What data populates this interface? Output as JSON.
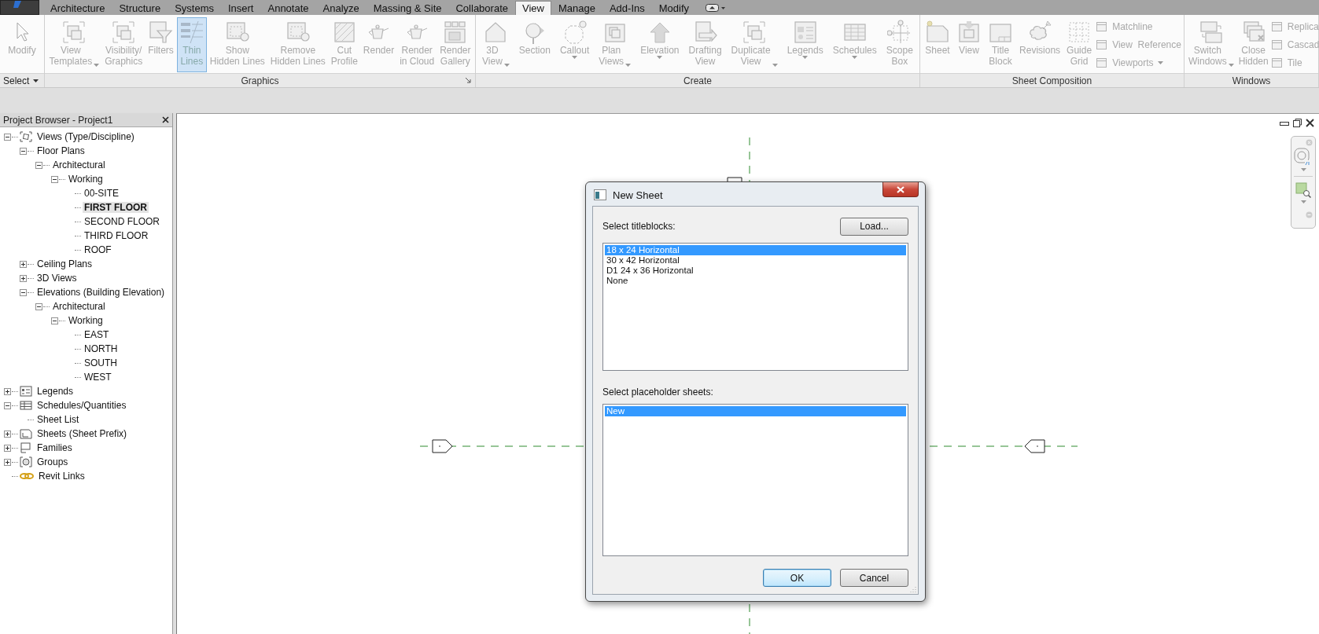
{
  "ribbon_tabs": [
    {
      "label": "Architecture",
      "selected": false
    },
    {
      "label": "Structure",
      "selected": false
    },
    {
      "label": "Systems",
      "selected": false
    },
    {
      "label": "Insert",
      "selected": false
    },
    {
      "label": "Annotate",
      "selected": false
    },
    {
      "label": "Analyze",
      "selected": false
    },
    {
      "label": "Massing & Site",
      "selected": false
    },
    {
      "label": "Collaborate",
      "selected": false
    },
    {
      "label": "View",
      "selected": true
    },
    {
      "label": "Manage",
      "selected": false
    },
    {
      "label": "Add-Ins",
      "selected": false
    },
    {
      "label": "Modify",
      "selected": false
    }
  ],
  "ribbon": {
    "disabled": true,
    "panels": [
      {
        "title": "Select",
        "dropdown": true,
        "launcher": false,
        "tools": [
          {
            "kind": "large",
            "label": "Modify",
            "selected": false,
            "dropdown": false
          }
        ]
      },
      {
        "title": "Graphics",
        "dropdown": false,
        "launcher": true,
        "tools": [
          {
            "kind": "large",
            "label": "View\nTemplates",
            "selected": false,
            "dropdown": true
          },
          {
            "kind": "large",
            "label": "Visibility/\nGraphics",
            "selected": false,
            "dropdown": false
          },
          {
            "kind": "large",
            "label": "Filters",
            "selected": false,
            "dropdown": false
          },
          {
            "kind": "large",
            "label": "Thin\nLines",
            "selected": true,
            "dropdown": false
          },
          {
            "kind": "large",
            "label": "Show\nHidden Lines",
            "selected": false,
            "dropdown": false
          },
          {
            "kind": "large",
            "label": "Remove\nHidden Lines",
            "selected": false,
            "dropdown": false
          },
          {
            "kind": "large",
            "label": "Cut\nProfile",
            "selected": false,
            "dropdown": false
          },
          {
            "kind": "large",
            "label": "Render",
            "selected": false,
            "dropdown": false
          },
          {
            "kind": "large",
            "label": "Render\nin Cloud",
            "selected": false,
            "dropdown": false
          },
          {
            "kind": "large",
            "label": "Render\nGallery",
            "selected": false,
            "dropdown": false
          }
        ]
      },
      {
        "title": "Create",
        "dropdown": false,
        "launcher": false,
        "tools": [
          {
            "kind": "large",
            "label": "3D\nView",
            "selected": false,
            "dropdown": true
          },
          {
            "kind": "large",
            "label": "Section",
            "selected": false,
            "dropdown": false
          },
          {
            "kind": "large",
            "label": "Callout",
            "selected": false,
            "dropdown": true
          },
          {
            "kind": "large",
            "label": "Plan\nViews",
            "selected": false,
            "dropdown": true
          },
          {
            "kind": "large",
            "label": "Elevation",
            "selected": false,
            "dropdown": true
          },
          {
            "kind": "large",
            "label": "Drafting\nView",
            "selected": false,
            "dropdown": false
          },
          {
            "kind": "large",
            "label": "Duplicate\nView",
            "selected": false,
            "dropdown": true
          },
          {
            "kind": "large",
            "label": "Legends",
            "selected": false,
            "dropdown": true
          },
          {
            "kind": "large",
            "label": "Schedules",
            "selected": false,
            "dropdown": true
          },
          {
            "kind": "large",
            "label": "Scope\nBox",
            "selected": false,
            "dropdown": false
          }
        ]
      },
      {
        "title": "Sheet Composition",
        "dropdown": false,
        "launcher": false,
        "tools": [
          {
            "kind": "large",
            "label": "Sheet",
            "selected": false,
            "dropdown": false
          },
          {
            "kind": "large",
            "label": "View",
            "selected": false,
            "dropdown": false
          },
          {
            "kind": "large",
            "label": "Title\nBlock",
            "selected": false,
            "dropdown": false
          },
          {
            "kind": "large",
            "label": "Revisions",
            "selected": false,
            "dropdown": false
          },
          {
            "kind": "large",
            "label": "Guide\nGrid",
            "selected": false,
            "dropdown": false
          },
          {
            "kind": "small",
            "label": "Matchline",
            "selected": false,
            "dropdown": false
          },
          {
            "kind": "small",
            "label": "View  Reference",
            "selected": false,
            "dropdown": false
          },
          {
            "kind": "small",
            "label": "Viewports",
            "selected": false,
            "dropdown": true
          }
        ]
      },
      {
        "title": "Windows",
        "dropdown": false,
        "launcher": false,
        "tools": [
          {
            "kind": "large",
            "label": "Switch\nWindows",
            "selected": false,
            "dropdown": true
          },
          {
            "kind": "large",
            "label": "Close\nHidden",
            "selected": false,
            "dropdown": false
          },
          {
            "kind": "small",
            "label": "Replica",
            "selected": false
          },
          {
            "kind": "small",
            "label": "Cascad",
            "selected": false
          },
          {
            "kind": "small",
            "label": "Tile",
            "selected": false
          }
        ]
      }
    ]
  },
  "project_browser": {
    "title": "Project Browser - Project1",
    "tree": [
      {
        "label": "Views (Type/Discipline)",
        "selected": false,
        "expanded": true,
        "children": [
          {
            "label": "Floor Plans",
            "selected": false,
            "expanded": true,
            "children": [
              {
                "label": "Architectural",
                "selected": false,
                "expanded": true,
                "children": [
                  {
                    "label": "Working",
                    "selected": false,
                    "expanded": true,
                    "children": [
                      {
                        "label": "00-SITE",
                        "selected": false
                      },
                      {
                        "label": "FIRST FLOOR",
                        "selected": true
                      },
                      {
                        "label": "SECOND FLOOR",
                        "selected": false
                      },
                      {
                        "label": "THIRD FLOOR",
                        "selected": false
                      },
                      {
                        "label": "ROOF",
                        "selected": false
                      }
                    ]
                  }
                ]
              }
            ]
          },
          {
            "label": "Ceiling Plans",
            "selected": false,
            "expanded": false
          },
          {
            "label": "3D Views",
            "selected": false,
            "expanded": false
          },
          {
            "label": "Elevations (Building Elevation)",
            "selected": false,
            "expanded": true,
            "children": [
              {
                "label": "Architectural",
                "selected": false,
                "expanded": true,
                "children": [
                  {
                    "label": "Working",
                    "selected": false,
                    "expanded": true,
                    "children": [
                      {
                        "label": "EAST",
                        "selected": false
                      },
                      {
                        "label": "NORTH",
                        "selected": false
                      },
                      {
                        "label": "SOUTH",
                        "selected": false
                      },
                      {
                        "label": "WEST",
                        "selected": false
                      }
                    ]
                  }
                ]
              }
            ]
          }
        ]
      },
      {
        "label": "Legends",
        "selected": false,
        "expanded": false
      },
      {
        "label": "Schedules/Quantities",
        "selected": false,
        "expanded": true,
        "children": [
          {
            "label": "Sheet List",
            "selected": false
          }
        ]
      },
      {
        "label": "Sheets (Sheet Prefix)",
        "selected": false,
        "expanded": false
      },
      {
        "label": "Families",
        "selected": false,
        "expanded": false
      },
      {
        "label": "Groups",
        "selected": false,
        "expanded": false
      },
      {
        "label": "Revit Links",
        "selected": false
      }
    ]
  },
  "dialog": {
    "title": "New Sheet",
    "titleblocks_label": "Select titleblocks:",
    "load_button": "Load...",
    "titleblocks": [
      {
        "label": "18 x 24 Horizontal",
        "selected": true
      },
      {
        "label": "30 x 42 Horizontal",
        "selected": false
      },
      {
        "label": "D1 24 x 36 Horizontal",
        "selected": false
      },
      {
        "label": "None",
        "selected": false
      }
    ],
    "placeholder_label": "Select placeholder sheets:",
    "placeholder_sheets": [
      {
        "label": "New",
        "selected": true
      }
    ],
    "ok_button": "OK",
    "cancel_button": "Cancel"
  }
}
